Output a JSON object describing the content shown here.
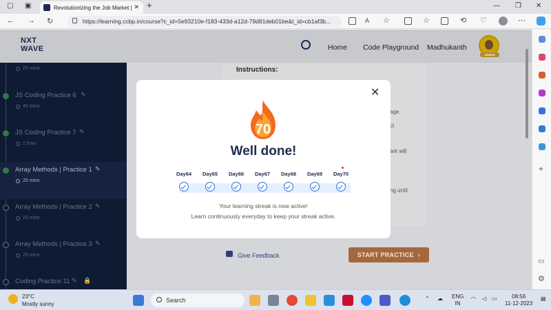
{
  "browser": {
    "tab_title": "Revolutionizing the Job Market |",
    "url": "https://learning.ccbp.in/course?c_id=5e93210e-f183-433d-a12d-79d81deb01be&t_id=cb1af3b..."
  },
  "header": {
    "logo_line1": "NXT",
    "logo_line2": "WAVE",
    "nav": [
      "Home",
      "Code Playground"
    ],
    "user_name": "Madhukanth",
    "badge": "GENIUS"
  },
  "sidebar": {
    "items": [
      {
        "title": "",
        "duration": "25 mins",
        "status": "done"
      },
      {
        "title": "JS Coding Practice 6",
        "duration": "45 mins",
        "status": "done"
      },
      {
        "title": "JS Coding Practice 7",
        "duration": "1 hour",
        "status": "done"
      },
      {
        "title": "Array Methods | Practice 1",
        "duration": "25 mins",
        "status": "active"
      },
      {
        "title": "Array Methods | Practice 2",
        "duration": "25 mins",
        "status": "todo"
      },
      {
        "title": "Array Methods | Practice 3",
        "duration": "25 mins",
        "status": "todo"
      },
      {
        "title": "Coding Practice 11",
        "duration": "",
        "status": "locked"
      }
    ]
  },
  "content": {
    "instructions_heading": "Instructions:",
    "partial_lines": [
      "age.",
      "ct",
      "ark will",
      "ng until"
    ],
    "feedback_label": "Give Feedback",
    "start_label": "START PRACTICE"
  },
  "modal": {
    "streak_count": "70",
    "heading": "Well done!",
    "days": [
      "Day64",
      "Day65",
      "Day66",
      "Day67",
      "Day68",
      "Day69",
      "Day70"
    ],
    "message_line1": "Your learning streak is now active!",
    "message_line2": "Learn continuously everyday to keep your streak active."
  },
  "taskbar": {
    "temperature": "23°C",
    "weather": "Mostly sunny",
    "search_label": "Search",
    "lang1": "ENG",
    "lang2": "IN",
    "time": "08:56",
    "date": "11-12-2023"
  },
  "colors": {
    "accent": "#2f6fd6",
    "sidebar_bg": "#0f1a33",
    "start_button": "#a6673c",
    "brand": "#1b2a59"
  }
}
